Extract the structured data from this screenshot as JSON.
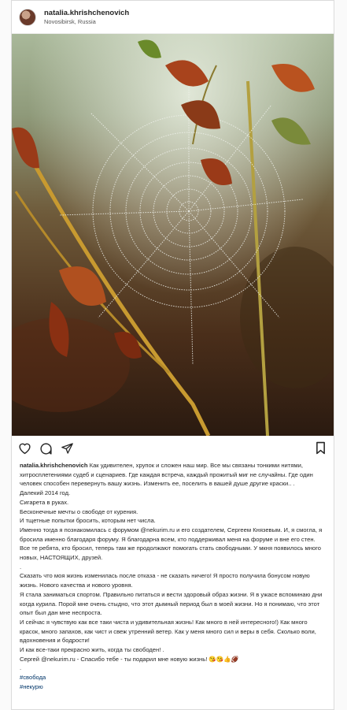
{
  "post": {
    "username": "natalia.khrishchenovich",
    "location": "Novosibirsk, Russia"
  },
  "actions": {
    "like_icon": "heart-outline-icon",
    "comment_icon": "speech-bubble-icon",
    "share_icon": "paper-plane-icon",
    "save_icon": "bookmark-icon"
  },
  "caption": {
    "username": "natalia.khrishchenovich",
    "first": "Как удивителен, хрупок и сложен наш мир. Все мы связаны тонкими нитями, хитросплетениями судеб и сценариев. Где каждая встреча, каждый прожитый миг не случайны. Где один человек способен перевернуть вашу жизнь. Изменить ее, поселить в вашей душе другие краски.. .",
    "lines": [
      "Далекий 2014 год.",
      "Сигарета в руках.",
      "Бесконечные мечты о свободе от курения.",
      "И тщетные попытки бросить, которым нет числа.",
      "Именно тогда я познакомилась с форумом @nekurim.ru и его создателем, Сергеем Князевым. И, я смогла, я бросила именно благодаря форуму. Я благодарна всем, кто поддерживал меня на форуме и вне его стен. Все те ребята, кто бросил, теперь там же продолжают помогать стать свободными. У мкня появилось много новых, НАСТОЯЩИХ, друзей."
    ],
    "dot1": ".",
    "lines2": [
      "Сказать что моя жизнь изменилась после отказа - не сказать ничего! Я просто получила бонусом новую жизнь. Нового качества и нового уровня.",
      "Я стала заниматься спортом. Правильно питаться и вести здоровый образ жизни. Я в ужасе вспоминаю дни когда курила. Порой мне очень стыдно, что этот дымный период был в моей жизни. Но я понимаю, что этот опыт был дан мне неспроста.",
      "И сейчас я чувствую как все таки чиста и удивительная жизнь! Как много в ней интересного!) Как много красок, много запахов, как чист и свеж утренний ветер. Как у меня много сил и веры в себя. Сколько воли, вдохновения и бодрости!",
      "И как все-таки прекрасно жить, когда ты свободен! .",
      "Сергей @nekurim.ru - Спасибо тебе - ты подарил мне новую жизнь! 😘😘👍🏈"
    ],
    "dot2": ".",
    "hashtags": [
      "#свобода",
      "#некурю"
    ]
  }
}
